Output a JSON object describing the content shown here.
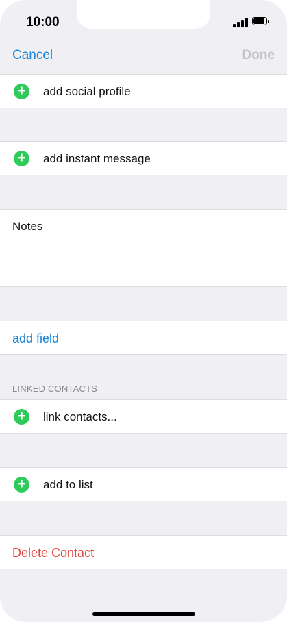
{
  "status": {
    "time": "10:00"
  },
  "nav": {
    "cancel_label": "Cancel",
    "done_label": "Done"
  },
  "rows": {
    "social_profile": "add social profile",
    "instant_message": "add instant message",
    "notes_label": "Notes",
    "add_field": "add field",
    "linked_contacts_header": "LINKED CONTACTS",
    "link_contacts": "link contacts...",
    "add_to_list": "add to list",
    "delete_contact": "Delete Contact"
  },
  "icons": {
    "plus_glyph": "+",
    "plus_icon_name": "add-circle-icon",
    "signal_icon_name": "cellular-signal-icon",
    "battery_icon_name": "battery-icon"
  },
  "colors": {
    "accent_blue": "#1a84d8",
    "add_green": "#2ecb5a",
    "danger_red": "#e2473f",
    "disabled_gray": "#c4c4c8",
    "background_gray": "#efeff4"
  }
}
